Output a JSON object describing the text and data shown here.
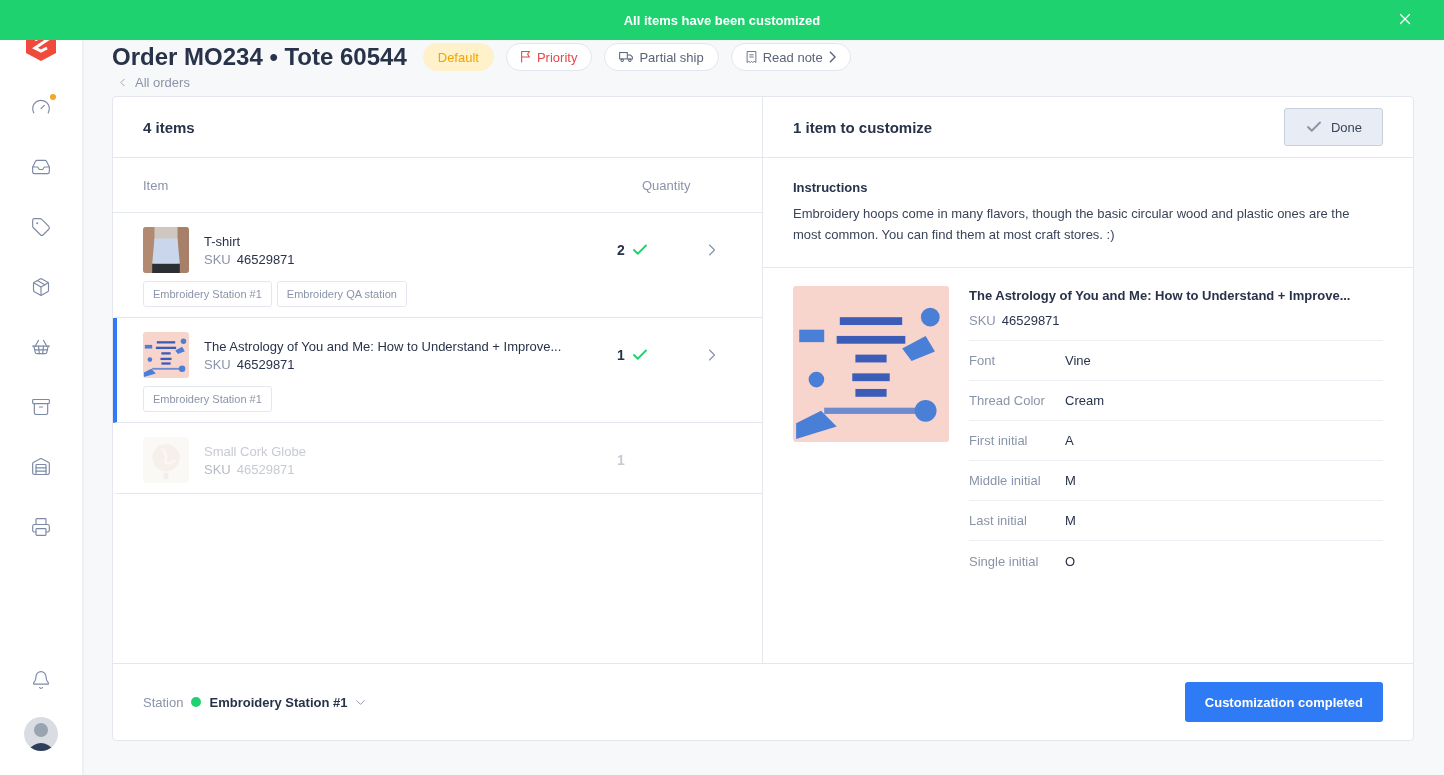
{
  "toast": {
    "message": "All items have been customized"
  },
  "sidebar": {
    "items": [
      {
        "kind": "gauge",
        "alert": true
      },
      {
        "kind": "inbox",
        "alert": false
      },
      {
        "kind": "tag",
        "alert": false
      },
      {
        "kind": "package",
        "alert": false
      },
      {
        "kind": "basket",
        "alert": false
      },
      {
        "kind": "box",
        "alert": false
      },
      {
        "kind": "warehouse",
        "alert": false
      },
      {
        "kind": "printer",
        "alert": false
      }
    ],
    "bottom": [
      {
        "kind": "bell"
      },
      {
        "kind": "avatar"
      }
    ]
  },
  "header": {
    "title": "Order MO234 • Tote 60544",
    "tags": [
      {
        "label": "Default",
        "kind": "status"
      },
      {
        "label": "Priority",
        "kind": "flag"
      },
      {
        "label": "Partial ship",
        "kind": "ship"
      },
      {
        "label": "Read note",
        "kind": "note"
      }
    ],
    "back_link": "All orders"
  },
  "items_panel": {
    "title": "4 items",
    "columns": [
      "Item",
      "Quantity"
    ],
    "rows": [
      {
        "name": "T-shirt",
        "sku_label": "SKU",
        "sku": "46529871",
        "quantity": "2",
        "done": true,
        "selected": false,
        "disabled": false,
        "stations": [
          "Embroidery Station #1",
          "Embroidery QA station"
        ]
      },
      {
        "name": "The Astrology of You and Me: How to Understand + Improve...",
        "sku_label": "SKU",
        "sku": "46529871",
        "quantity": "1",
        "done": true,
        "selected": true,
        "disabled": false,
        "stations": [
          "Embroidery Station #1"
        ]
      },
      {
        "name": "Small Cork Globe",
        "sku_label": "SKU",
        "sku": "46529871",
        "quantity": "1",
        "done": false,
        "selected": false,
        "disabled": true,
        "stations": []
      }
    ]
  },
  "customize_panel": {
    "title": "1 item to customize",
    "done_button": "Done",
    "instructions_title": "Instructions",
    "instructions": "Embroidery hoops come in many flavors, though the basic circular wood and plastic ones are the most common. You can find them at most craft stores. :)",
    "product": {
      "name": "The Astrology of You and Me: How to Understand + Improve...",
      "sku_label": "SKU",
      "sku": "46529871",
      "attributes": [
        {
          "label": "Font",
          "value": "Vine"
        },
        {
          "label": "Thread Color",
          "value": "Cream"
        },
        {
          "label": "First initial",
          "value": "A"
        },
        {
          "label": "Middle initial",
          "value": "M"
        },
        {
          "label": "Last initial",
          "value": "M"
        },
        {
          "label": "Single initial",
          "value": "O"
        }
      ]
    }
  },
  "footer": {
    "station_label": "Station",
    "station": "Embroidery Station #1",
    "color": "#1ed36f",
    "action": "Customization completed"
  }
}
